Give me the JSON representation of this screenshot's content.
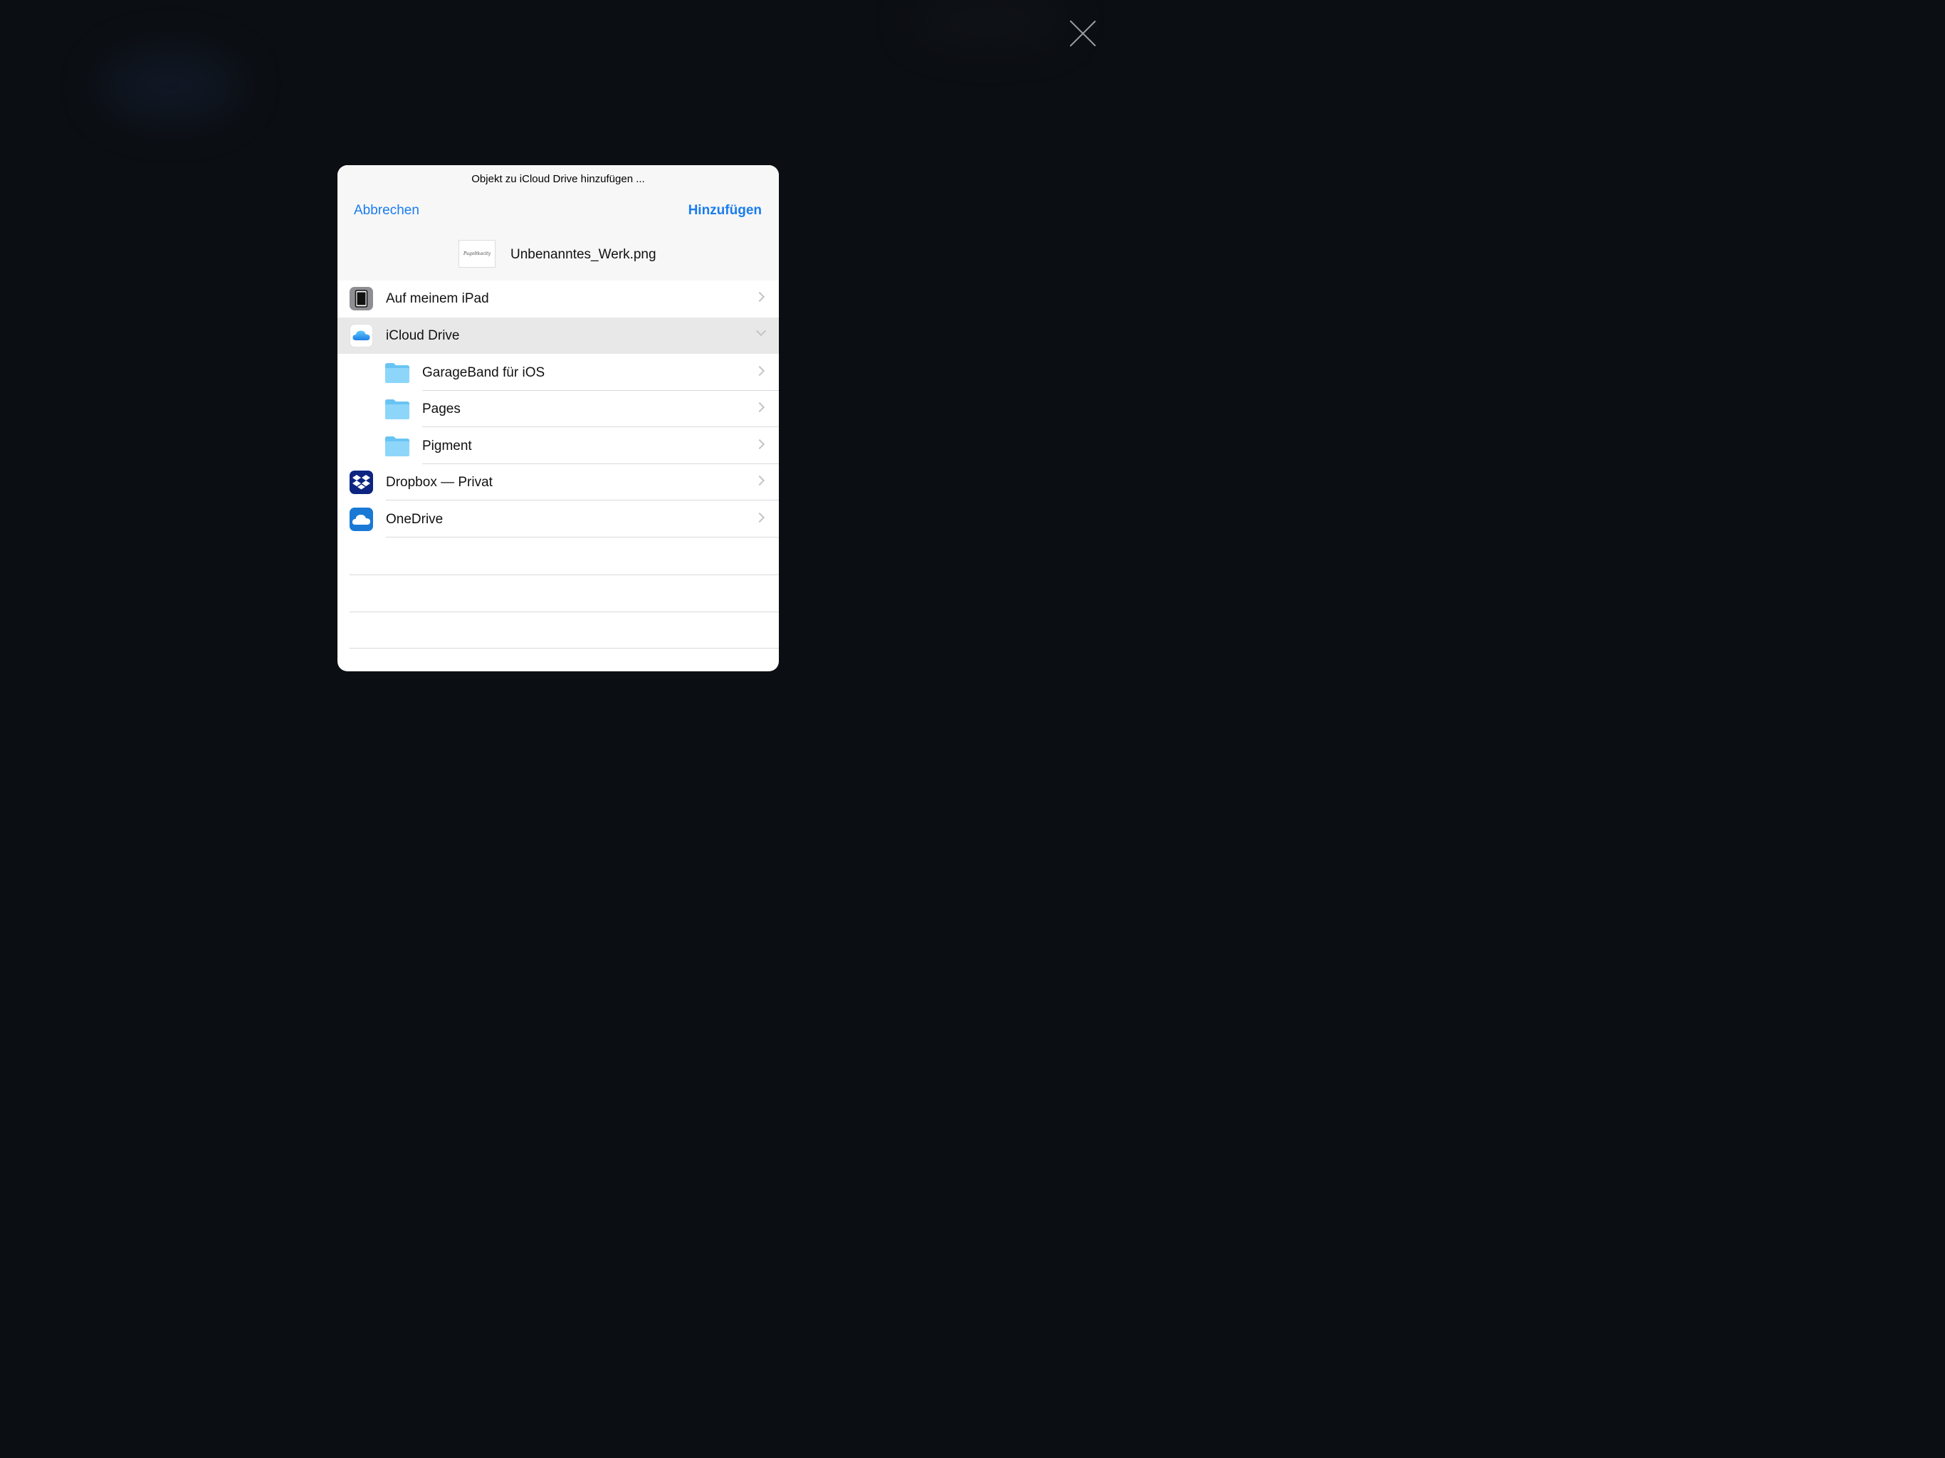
{
  "dialog": {
    "title": "Objekt zu iCloud Drive hinzufügen ...",
    "cancel_label": "Abbrechen",
    "add_label": "Hinzufügen",
    "file_name": "Unbenanntes_Werk.png",
    "thumbnail_text": "Pugoltkacity"
  },
  "locations": [
    {
      "label": "Auf meinem iPad",
      "icon": "ipad-icon"
    },
    {
      "label": "iCloud Drive",
      "icon": "icloud-icon",
      "expanded": true
    },
    {
      "label": "GarageBand für iOS",
      "icon": "folder-icon"
    },
    {
      "label": "Pages",
      "icon": "folder-icon"
    },
    {
      "label": "Pigment",
      "icon": "folder-icon"
    },
    {
      "label": "Dropbox — Privat",
      "icon": "dropbox-icon"
    },
    {
      "label": "OneDrive",
      "icon": "onedrive-icon"
    }
  ],
  "colors": {
    "accent": "#1a7cf0",
    "selected_row": "#e8e8e8",
    "folder": "#7dcdf6",
    "dropbox": "#0d2481",
    "onedrive": "#1a79d4"
  }
}
